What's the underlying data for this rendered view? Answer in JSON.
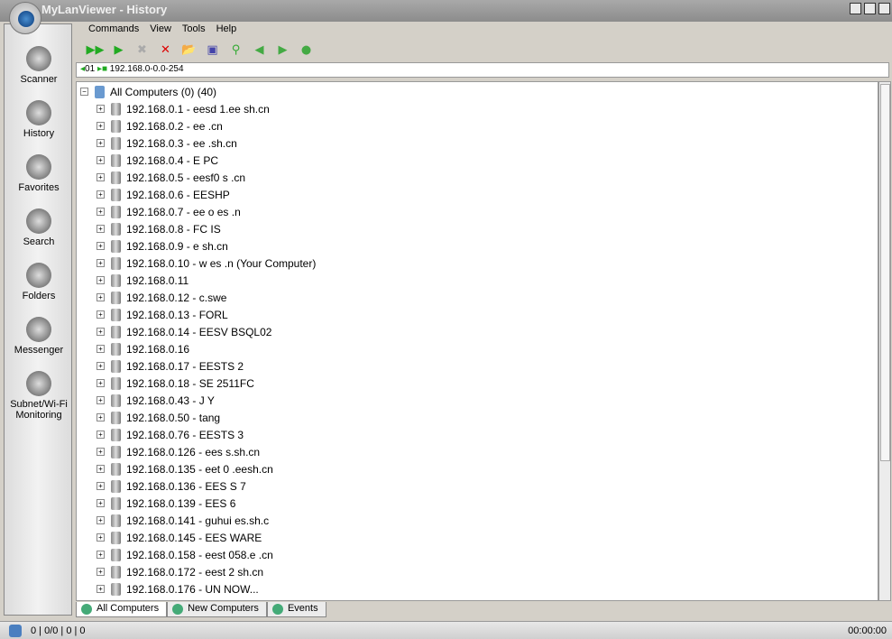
{
  "window": {
    "title": "MyLanViewer - History"
  },
  "sidebar": {
    "items": [
      {
        "label": "Scanner",
        "icon": "scanner-icon"
      },
      {
        "label": "History",
        "icon": "history-icon"
      },
      {
        "label": "Favorites",
        "icon": "star-icon"
      },
      {
        "label": "Search",
        "icon": "search-icon"
      },
      {
        "label": "Folders",
        "icon": "folders-icon"
      },
      {
        "label": "Messenger",
        "icon": "messenger-icon"
      },
      {
        "label": "Subnet/Wi-Fi Monitoring",
        "icon": "monitoring-icon"
      }
    ]
  },
  "menu": [
    "Commands",
    "View",
    "Tools",
    "Help"
  ],
  "toolbar": [
    "start-scan-icon",
    "quick-scan-icon",
    "stop-icon",
    "delete-icon",
    "open-icon",
    "save-icon",
    "find-icon",
    "back-icon",
    "forward-icon",
    "refresh-icon"
  ],
  "address": {
    "index": "01",
    "range": "192.168.0-0.0-254"
  },
  "tree": {
    "root": "All Computers (0) (40)",
    "rows": [
      "192.168.0.1 - eesd   1.ee  sh.cn",
      "192.168.0.2 - ee        .cn",
      "192.168.0.3 - ee        .sh.cn",
      "192.168.0.4 - E     PC",
      "192.168.0.5 - eesf0     s   .cn",
      "192.168.0.6 - EESHP",
      "192.168.0.7 - ee   o   es   .n",
      "192.168.0.8 - FC        IS",
      "192.168.0.9 - e          sh.cn",
      "192.168.0.10 - w     es    .n (Your Computer)",
      "192.168.0.11",
      "192.168.0.12 - c.swe",
      "192.168.0.13 - FORL",
      "192.168.0.14 - EESV  BSQL02",
      "192.168.0.16",
      "192.168.0.17 - EESTS    2",
      "192.168.0.18 - SE      2511FC",
      "192.168.0.43 - J    Y",
      "192.168.0.50 - tang",
      "192.168.0.76 - EESTS  3",
      "192.168.0.126 - ees        s.sh.cn",
      "192.168.0.135 - eet   0   .eesh.cn",
      "192.168.0.136 - EES  S  7",
      "192.168.0.139 - EES    6",
      "192.168.0.141 - guhui   es.sh.c",
      "192.168.0.145 - EES   WARE",
      "192.168.0.158 - eest  058.e    .cn",
      "192.168.0.172 - eest  2    sh.cn",
      "192.168.0.176 - UN  NOW..."
    ]
  },
  "tabs": [
    "All Computers",
    "New Computers",
    "Events"
  ],
  "status": {
    "counts": "0 | 0/0 | 0 | 0",
    "time": "00:00:00"
  }
}
